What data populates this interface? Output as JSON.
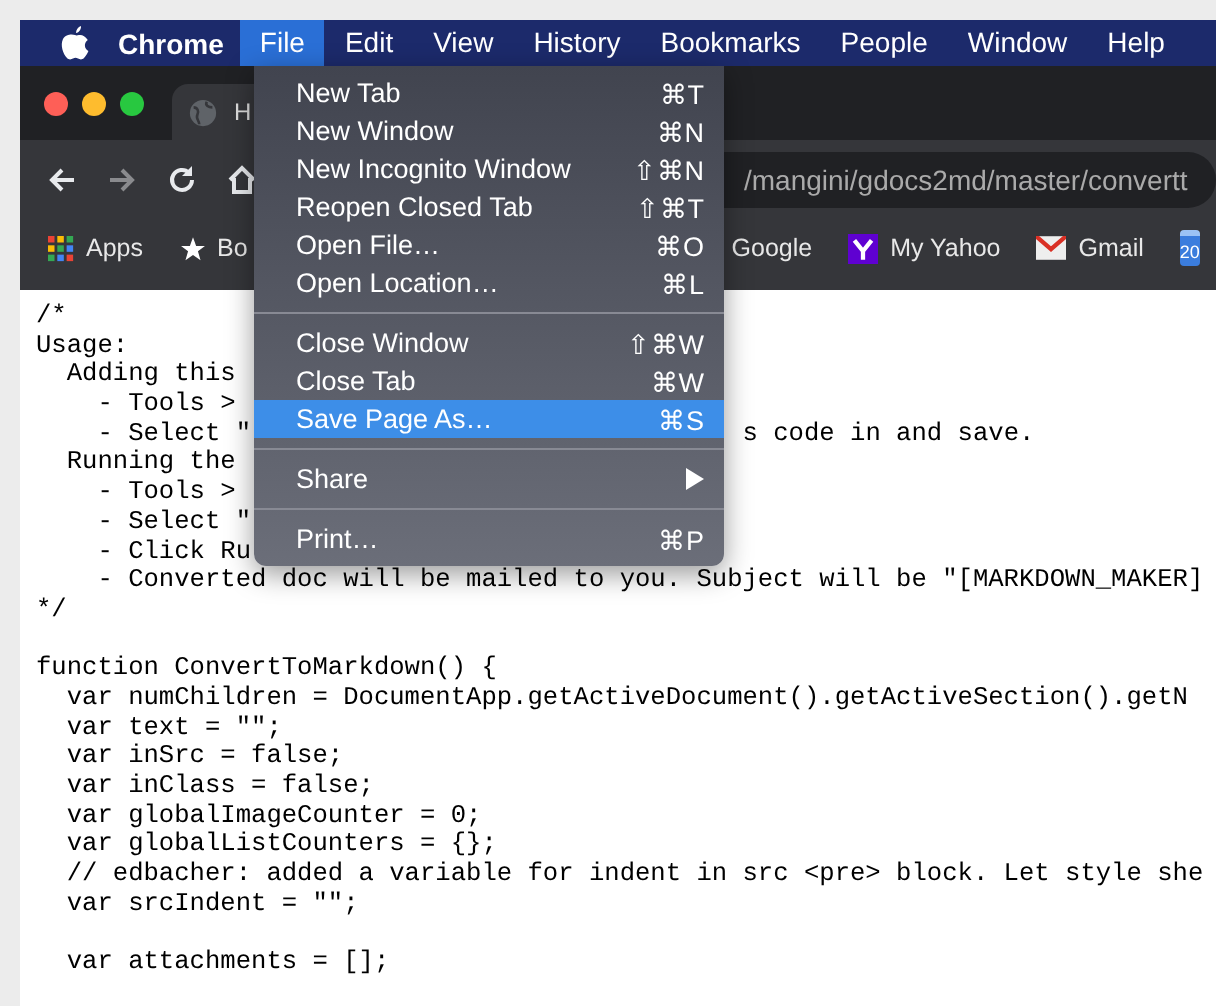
{
  "menubar": {
    "app": "Chrome",
    "menus": [
      {
        "label": "File",
        "selected": true
      },
      {
        "label": "Edit",
        "selected": false
      },
      {
        "label": "View",
        "selected": false
      },
      {
        "label": "History",
        "selected": false
      },
      {
        "label": "Bookmarks",
        "selected": false
      },
      {
        "label": "People",
        "selected": false
      },
      {
        "label": "Window",
        "selected": false
      },
      {
        "label": "Help",
        "selected": false
      }
    ]
  },
  "file_menu": [
    {
      "kind": "item",
      "label": "New Tab",
      "shortcut": "⌘T",
      "selected": false
    },
    {
      "kind": "item",
      "label": "New Window",
      "shortcut": "⌘N",
      "selected": false
    },
    {
      "kind": "item",
      "label": "New Incognito Window",
      "shortcut": "⇧⌘N",
      "selected": false
    },
    {
      "kind": "item",
      "label": "Reopen Closed Tab",
      "shortcut": "⇧⌘T",
      "selected": false
    },
    {
      "kind": "item",
      "label": "Open File…",
      "shortcut": "⌘O",
      "selected": false
    },
    {
      "kind": "item",
      "label": "Open Location…",
      "shortcut": "⌘L",
      "selected": false
    },
    {
      "kind": "separator"
    },
    {
      "kind": "item",
      "label": "Close Window",
      "shortcut": "⇧⌘W",
      "selected": false
    },
    {
      "kind": "item",
      "label": "Close Tab",
      "shortcut": "⌘W",
      "selected": false
    },
    {
      "kind": "item",
      "label": "Save Page As…",
      "shortcut": "⌘S",
      "selected": true
    },
    {
      "kind": "separator"
    },
    {
      "kind": "submenu",
      "label": "Share",
      "selected": false
    },
    {
      "kind": "separator"
    },
    {
      "kind": "item",
      "label": "Print…",
      "shortcut": "⌘P",
      "selected": false
    }
  ],
  "tab": {
    "title": "H"
  },
  "address_bar": {
    "value": "/mangini/gdocs2md/master/convertt"
  },
  "bookmarks": [
    {
      "kind": "apps",
      "label": "Apps"
    },
    {
      "kind": "star",
      "label": "Bo"
    },
    {
      "kind": "plain",
      "label": "Google"
    },
    {
      "kind": "yahoo",
      "label": "My Yahoo"
    },
    {
      "kind": "gmail",
      "label": "Gmail"
    },
    {
      "kind": "calendar",
      "label": "20"
    }
  ],
  "code": {
    "blocks": [
      [
        {
          "text": "/*"
        },
        {
          "text": "Usage:"
        },
        {
          "text": "  Adding this"
        },
        {
          "text": "    - Tools >"
        },
        {
          "text": "    - Select \"",
          "tail": "s code in and save."
        },
        {
          "text": "  Running the"
        },
        {
          "text": "    - Tools >"
        },
        {
          "text": "    - Select \""
        },
        {
          "text": "    - Click Ru"
        },
        {
          "text": "    - Converted doc will be mailed to you. Subject will be \"[MARKDOWN_MAKER]"
        },
        {
          "text": "*/"
        }
      ],
      [
        {
          "text": "function ConvertToMarkdown() {"
        },
        {
          "text": "  var numChildren = DocumentApp.getActiveDocument().getActiveSection().getN"
        },
        {
          "text": "  var text = \"\";"
        },
        {
          "text": "  var inSrc = false;"
        },
        {
          "text": "  var inClass = false;"
        },
        {
          "text": "  var globalImageCounter = 0;"
        },
        {
          "text": "  var globalListCounters = {};"
        },
        {
          "text": "  // edbacher: added a variable for indent in src <pre> block. Let style she"
        },
        {
          "text": "  var srcIndent = \"\";"
        }
      ],
      [
        {
          "text": "  var attachments = [];"
        }
      ]
    ]
  }
}
